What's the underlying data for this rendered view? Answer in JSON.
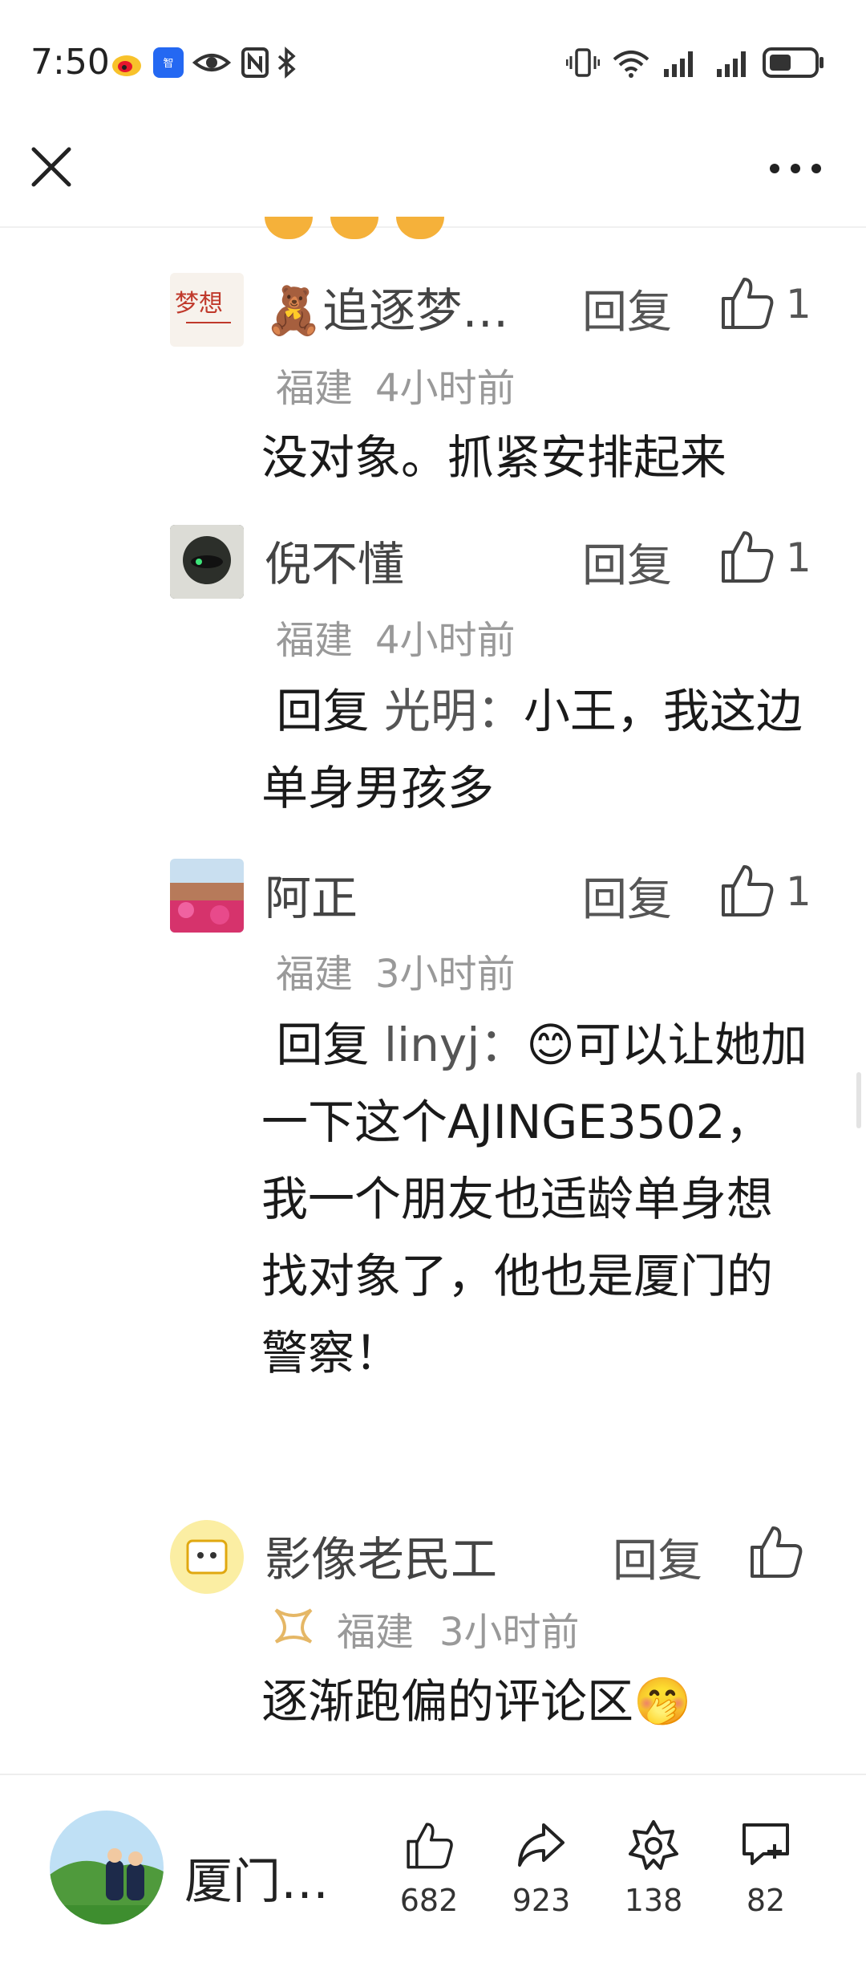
{
  "status_bar": {
    "time": "7:50",
    "icons": [
      "weibo-icon",
      "baidu-app-icon",
      "eye-icon",
      "nfc-icon",
      "bluetooth-icon",
      "vibrate-icon",
      "wifi-icon",
      "signal-icon",
      "signal-icon",
      "battery-icon"
    ]
  },
  "top_bar": {
    "close_icon": "close-icon",
    "more_icon": "more-icon"
  },
  "comments": [
    {
      "name": "🧸追逐梦…",
      "reply_label": "回复",
      "likes": "1",
      "region": "福建",
      "time": "4小时前",
      "text": "没对象。抓紧安排起来",
      "avatar_text": "梦想"
    },
    {
      "name": "倪不懂",
      "reply_label": "回复",
      "likes": "1",
      "region": "福建",
      "time": "4小时前",
      "reply_prefix": "回复",
      "reply_to": "光明：",
      "text": "小王，我这边单身男孩多"
    },
    {
      "name": "阿正",
      "reply_label": "回复",
      "likes": "1",
      "region": "福建",
      "time": "3小时前",
      "reply_prefix": "回复",
      "reply_to": "linyj：",
      "emoji": "😊",
      "text": "可以让她加一下这个AJINGE3502，我一个朋友也适龄单身想找对象了，他也是厦门的警察！"
    },
    {
      "name": "影像老民工",
      "reply_label": "回复",
      "likes": "",
      "region": "福建",
      "time": "3小时前",
      "text": "逐渐跑偏的评论区",
      "emoji": "🤭"
    }
  ],
  "bottom_bar": {
    "account_name": "厦门…",
    "like_count": "682",
    "share_count": "923",
    "favorite_count": "138",
    "comment_count": "82"
  }
}
